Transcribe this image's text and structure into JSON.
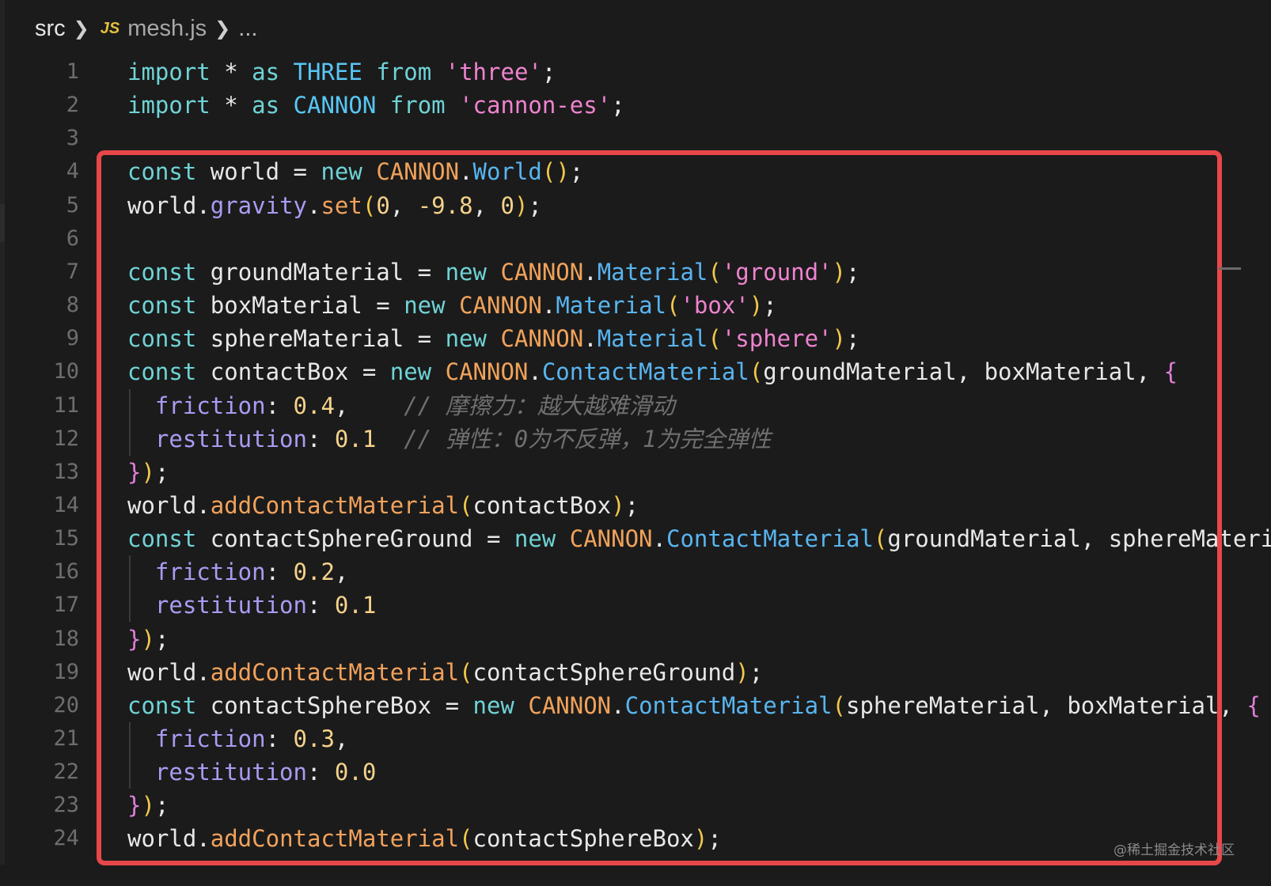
{
  "breadcrumb": {
    "folder": "src",
    "file_icon": "JS",
    "file": "mesh.js",
    "more": "..."
  },
  "lines": [
    {
      "n": "1",
      "t": [
        "import",
        " * ",
        "as",
        " ",
        "THREE",
        " ",
        "from",
        " ",
        "'three'",
        ";"
      ]
    },
    {
      "n": "2",
      "t": [
        "import",
        " * ",
        "as",
        " ",
        "CANNON",
        " ",
        "from",
        " ",
        "'cannon-es'",
        ";"
      ]
    },
    {
      "n": "3",
      "t": []
    },
    {
      "n": "4",
      "t": [
        "const",
        " world = ",
        "new",
        " ",
        "CANNON",
        ".",
        "World",
        "()",
        ";"
      ]
    },
    {
      "n": "5",
      "t": [
        "world.",
        "gravity",
        ".",
        "set",
        "(",
        "0",
        ", ",
        "-9.8",
        ", ",
        "0",
        ")",
        ";"
      ]
    },
    {
      "n": "6",
      "t": []
    },
    {
      "n": "7",
      "t": [
        "const",
        " groundMaterial = ",
        "new",
        " ",
        "CANNON",
        ".",
        "Material",
        "(",
        "'ground'",
        ")",
        ";"
      ]
    },
    {
      "n": "8",
      "t": [
        "const",
        " boxMaterial = ",
        "new",
        " ",
        "CANNON",
        ".",
        "Material",
        "(",
        "'box'",
        ")",
        ";"
      ]
    },
    {
      "n": "9",
      "t": [
        "const",
        " sphereMaterial = ",
        "new",
        " ",
        "CANNON",
        ".",
        "Material",
        "(",
        "'sphere'",
        ")",
        ";"
      ]
    },
    {
      "n": "10",
      "t": [
        "const",
        " contactBox = ",
        "new",
        " ",
        "CANNON",
        ".",
        "ContactMaterial",
        "(",
        "groundMaterial, boxMaterial, ",
        "{"
      ]
    },
    {
      "n": "11",
      "t": [
        "  ",
        "friction",
        ": ",
        "0.4",
        ",    ",
        "// 摩擦力：越大越难滑动"
      ]
    },
    {
      "n": "12",
      "t": [
        "  ",
        "restitution",
        ": ",
        "0.1",
        "  ",
        "// 弹性：0为不反弹，1为完全弹性"
      ]
    },
    {
      "n": "13",
      "t": [
        "}",
        ")",
        ";"
      ]
    },
    {
      "n": "14",
      "t": [
        "world.",
        "addContactMaterial",
        "(",
        "contactBox",
        ")",
        ";"
      ]
    },
    {
      "n": "15",
      "t": [
        "const",
        " contactSphereGround = ",
        "new",
        " ",
        "CANNON",
        ".",
        "ContactMaterial",
        "(",
        "groundMaterial, sphereMateri"
      ]
    },
    {
      "n": "16",
      "t": [
        "  ",
        "friction",
        ": ",
        "0.2",
        ","
      ]
    },
    {
      "n": "17",
      "t": [
        "  ",
        "restitution",
        ": ",
        "0.1"
      ]
    },
    {
      "n": "18",
      "t": [
        "}",
        ")",
        ";"
      ]
    },
    {
      "n": "19",
      "t": [
        "world.",
        "addContactMaterial",
        "(",
        "contactSphereGround",
        ")",
        ";"
      ]
    },
    {
      "n": "20",
      "t": [
        "const",
        " contactSphereBox = ",
        "new",
        " ",
        "CANNON",
        ".",
        "ContactMaterial",
        "(",
        "sphereMaterial, boxMaterial, ",
        "{"
      ]
    },
    {
      "n": "21",
      "t": [
        "  ",
        "friction",
        ": ",
        "0.3",
        ","
      ]
    },
    {
      "n": "22",
      "t": [
        "  ",
        "restitution",
        ": ",
        "0.0"
      ]
    },
    {
      "n": "23",
      "t": [
        "}",
        ")",
        ";"
      ]
    },
    {
      "n": "24",
      "t": [
        "world.",
        "addContactMaterial",
        "(",
        "contactSphereBox",
        ")",
        ";"
      ]
    }
  ],
  "styles": [
    [
      "kw",
      "",
      "kw",
      "",
      "ns2",
      "",
      "kw",
      "",
      "str",
      ""
    ],
    [
      "kw",
      "",
      "kw",
      "",
      "ns2",
      "",
      "kw",
      "",
      "str",
      ""
    ],
    [],
    [
      "kw",
      "",
      "kw",
      "",
      "ns",
      "",
      "cls",
      "par",
      ""
    ],
    [
      "",
      "prop",
      "",
      "fn",
      "par",
      "num",
      "",
      "num",
      "",
      "num",
      "par",
      ""
    ],
    [],
    [
      "kw",
      "",
      "kw",
      "",
      "ns",
      "",
      "cls",
      "par",
      "str",
      "par",
      ""
    ],
    [
      "kw",
      "",
      "kw",
      "",
      "ns",
      "",
      "cls",
      "par",
      "str",
      "par",
      ""
    ],
    [
      "kw",
      "",
      "kw",
      "",
      "ns",
      "",
      "cls",
      "par",
      "str",
      "par",
      ""
    ],
    [
      "kw",
      "",
      "kw",
      "",
      "ns",
      "",
      "cls",
      "par",
      "",
      "brc"
    ],
    [
      "",
      "prop",
      "",
      "num",
      "",
      "cmt"
    ],
    [
      "",
      "prop",
      "",
      "num",
      "",
      "cmt"
    ],
    [
      "brc",
      "par",
      ""
    ],
    [
      "",
      "fn",
      "par",
      "",
      "par",
      ""
    ],
    [
      "kw",
      "",
      "kw",
      "",
      "ns",
      "",
      "cls",
      "par",
      ""
    ],
    [
      "",
      "prop",
      "",
      "num",
      ""
    ],
    [
      "",
      "prop",
      "",
      "num"
    ],
    [
      "brc",
      "par",
      ""
    ],
    [
      "",
      "fn",
      "par",
      "",
      "par",
      ""
    ],
    [
      "kw",
      "",
      "kw",
      "",
      "ns",
      "",
      "cls",
      "par",
      "",
      "brc"
    ],
    [
      "",
      "prop",
      "",
      "num",
      ""
    ],
    [
      "",
      "prop",
      "",
      "num"
    ],
    [
      "brc",
      "par",
      ""
    ],
    [
      "",
      "fn",
      "par",
      "",
      "par",
      ""
    ]
  ],
  "indented_lines": [
    "11",
    "12",
    "16",
    "17",
    "21",
    "22"
  ],
  "highlight_color": "#e8474a",
  "watermark": "@稀土掘金技术社区"
}
